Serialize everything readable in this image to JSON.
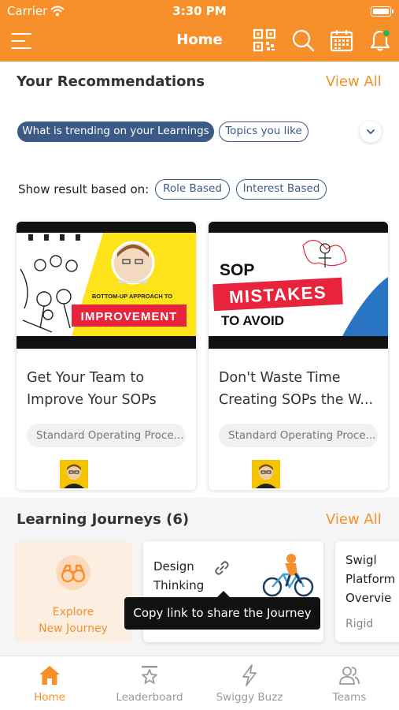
{
  "status_bar": {
    "carrier": "Carrier",
    "time": "3:30 PM"
  },
  "nav": {
    "title": "Home",
    "icons": [
      "menu-icon",
      "qr-code-icon",
      "search-icon",
      "calendar-icon",
      "bell-icon"
    ],
    "colors": {
      "brand": "#f7902a",
      "notification_dot": "#1db954"
    }
  },
  "recommendations": {
    "title": "Your Recommendations",
    "view_all": "View All",
    "tabs": [
      {
        "label": "What is trending on your Learnings",
        "active": true
      },
      {
        "label": "Topics you like",
        "active": false
      }
    ],
    "filter_label": "Show result based on:",
    "filters": [
      "Role Based",
      "Interest Based"
    ],
    "cards": [
      {
        "thumb_text": [
          "BOTTOM-UP APPROACH TO",
          "IMPROVEMENT"
        ],
        "title": "Get Your Team to Improve Your SOPs",
        "tag": "Standard Operating Proce..."
      },
      {
        "thumb_text": [
          "SOP",
          "MISTAKES",
          "TO AVOID"
        ],
        "title": "Don't Waste Time Creating SOPs the W...",
        "tag": "Standard Operating Proce..."
      }
    ]
  },
  "journeys": {
    "title": "Learning Journeys (6)",
    "view_all": "View All",
    "explore": [
      "Explore",
      "New Journey"
    ],
    "items": [
      {
        "title_lines": [
          "Design",
          "Thinking"
        ]
      },
      {
        "title_lines": [
          "Swigl",
          "Platform",
          "Overvie"
        ],
        "sub": "Rigid"
      }
    ],
    "tooltip": "Copy link to share the Journey"
  },
  "tabbar": {
    "tabs": [
      {
        "label": "Home",
        "icon": "home-icon",
        "active": true
      },
      {
        "label": "Leaderboard",
        "icon": "star-trophy-icon",
        "active": false
      },
      {
        "label": "Swiggy Buzz",
        "icon": "lightning-icon",
        "active": false
      },
      {
        "label": "Teams",
        "icon": "teams-icon",
        "active": false
      }
    ]
  }
}
